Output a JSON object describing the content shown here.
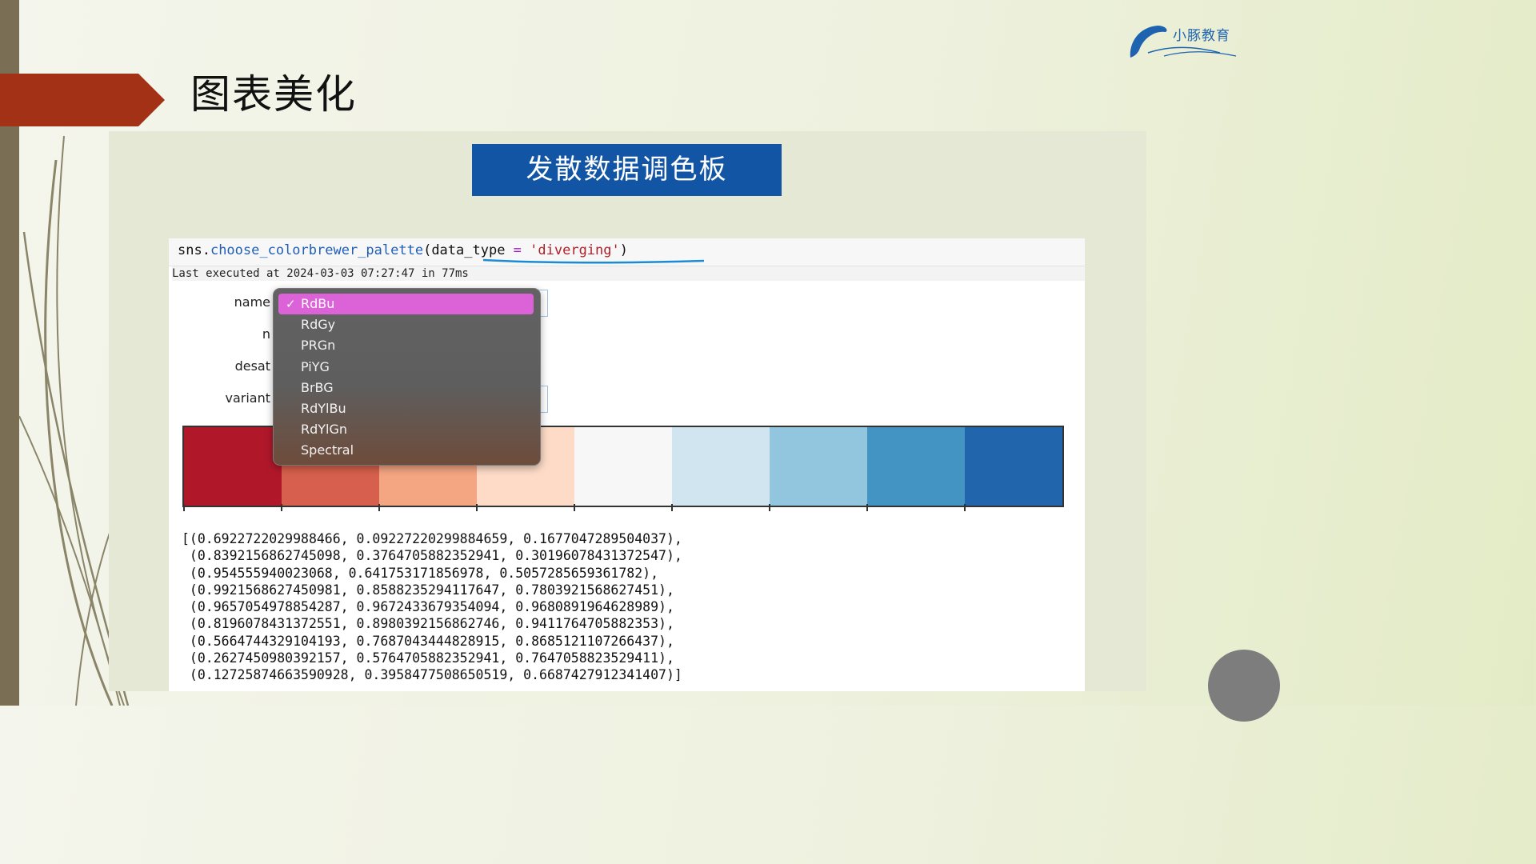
{
  "slide": {
    "title": "图表美化",
    "banner": "发散数据调色板",
    "logo_text": "小豚教育"
  },
  "colors": {
    "accent_arrow": "#a33115",
    "banner_bg": "#1355a5",
    "dropdown_selected": "#dc62d8",
    "left_bar": "#7a6e55"
  },
  "notebook": {
    "code": {
      "prefix": "sns.",
      "function": "choose_colorbrewer_palette",
      "open": "(",
      "arg_name": "data_type",
      "equals": " = ",
      "arg_value": "'diverging'",
      "close": ")"
    },
    "exec_info": "Last executed at 2024-03-03 07:27:47 in 77ms",
    "widgets": {
      "name_label": "name",
      "n_label": "n",
      "desat_label": "desat",
      "variant_label": "variant"
    },
    "dropdown": {
      "options": [
        "RdBu",
        "RdGy",
        "PRGn",
        "PiYG",
        "BrBG",
        "RdYlBu",
        "RdYlGn",
        "Spectral"
      ],
      "selected": "RdBu",
      "check_icon": "✓"
    },
    "palette_colors": [
      "#b0182a",
      "#d6604d",
      "#f4a582",
      "#fddbc7",
      "#f7f7f7",
      "#d1e5f0",
      "#92c5de",
      "#4393c3",
      "#2166ac"
    ],
    "output_lines": [
      "[(0.6922722029988466, 0.09227220299884659, 0.1677047289504037),",
      " (0.8392156862745098, 0.3764705882352941, 0.30196078431372547),",
      " (0.954555940023068, 0.641753171856978, 0.5057285659361782),",
      " (0.9921568627450981, 0.8588235294117647, 0.7803921568627451),",
      " (0.9657054978854287, 0.9672433679354094, 0.9680891964628989),",
      " (0.8196078431372551, 0.8980392156862746, 0.9411764705882353),",
      " (0.5664744329104193, 0.7687043444828915, 0.8685121107266437),",
      " (0.2627450980392157, 0.5764705882352941, 0.7647058823529411),",
      " (0.12725874663590928, 0.3958477508650519, 0.6687427912341407)]"
    ]
  }
}
